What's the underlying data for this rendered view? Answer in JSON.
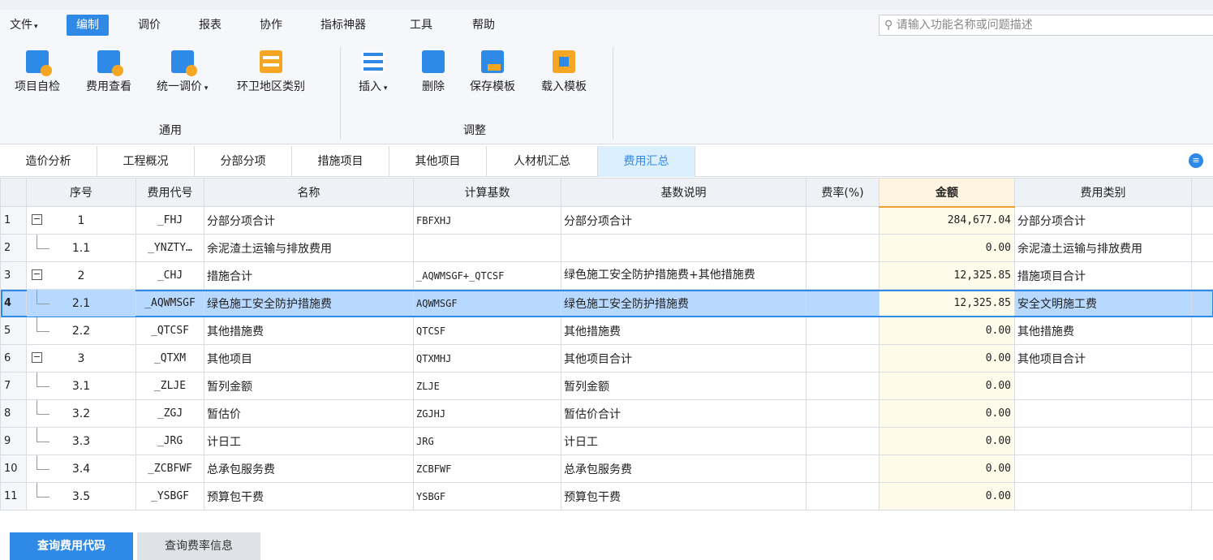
{
  "menubar": {
    "items": [
      "文件",
      "编制",
      "调价",
      "报表",
      "协作",
      "指标神器",
      "工具",
      "帮助"
    ],
    "search_placeholder": "请输入功能名称或问题描述"
  },
  "ribbon": {
    "general": [
      "项目自检",
      "费用查看",
      "统一调价",
      "环卫地区类别"
    ],
    "general_label": "通用",
    "adjust": [
      "插入",
      "删除",
      "保存模板",
      "载入模板"
    ],
    "adjust_label": "调整"
  },
  "tabs": [
    "造价分析",
    "工程概况",
    "分部分项",
    "措施项目",
    "其他项目",
    "人材机汇总",
    "费用汇总"
  ],
  "table": {
    "headers": [
      "序号",
      "费用代号",
      "名称",
      "计算基数",
      "基数说明",
      "费率(%)",
      "金额",
      "费用类别"
    ],
    "rows": [
      {
        "n": "1",
        "seq": "1",
        "code": "_FHJ",
        "name": "分部分项合计",
        "basis": "FBFXHJ",
        "desc": "分部分项合计",
        "rate": "",
        "amount": "284,677.04",
        "cat": "分部分项合计"
      },
      {
        "n": "2",
        "seq": "1.1",
        "code": "_YNZTY…",
        "name": "余泥渣土运输与排放费用",
        "basis": "",
        "desc": "",
        "rate": "",
        "amount": "0.00",
        "cat": "余泥渣土运输与排放费用"
      },
      {
        "n": "3",
        "seq": "2",
        "code": "_CHJ",
        "name": "措施合计",
        "basis": "_AQWMSGF+_QTCSF",
        "desc": "绿色施工安全防护措施费+其他措施费",
        "rate": "",
        "amount": "12,325.85",
        "cat": "措施项目合计"
      },
      {
        "n": "4",
        "seq": "2.1",
        "code": "_AQWMSGF",
        "name": "绿色施工安全防护措施费",
        "basis": "AQWMSGF",
        "desc": "绿色施工安全防护措施费",
        "rate": "",
        "amount": "12,325.85",
        "cat": "安全文明施工费"
      },
      {
        "n": "5",
        "seq": "2.2",
        "code": "_QTCSF",
        "name": "其他措施费",
        "basis": "QTCSF",
        "desc": "其他措施费",
        "rate": "",
        "amount": "0.00",
        "cat": "其他措施费"
      },
      {
        "n": "6",
        "seq": "3",
        "code": "_QTXM",
        "name": "其他项目",
        "basis": "QTXMHJ",
        "desc": "其他项目合计",
        "rate": "",
        "amount": "0.00",
        "cat": "其他项目合计"
      },
      {
        "n": "7",
        "seq": "3.1",
        "code": "_ZLJE",
        "name": "暂列金额",
        "basis": "ZLJE",
        "desc": "暂列金额",
        "rate": "",
        "amount": "0.00",
        "cat": ""
      },
      {
        "n": "8",
        "seq": "3.2",
        "code": "_ZGJ",
        "name": "暂估价",
        "basis": "ZGJHJ",
        "desc": "暂估价合计",
        "rate": "",
        "amount": "0.00",
        "cat": ""
      },
      {
        "n": "9",
        "seq": "3.3",
        "code": "_JRG",
        "name": "计日工",
        "basis": "JRG",
        "desc": "计日工",
        "rate": "",
        "amount": "0.00",
        "cat": ""
      },
      {
        "n": "10",
        "seq": "3.4",
        "code": "_ZCBFWF",
        "name": "总承包服务费",
        "basis": "ZCBFWF",
        "desc": "总承包服务费",
        "rate": "",
        "amount": "0.00",
        "cat": ""
      },
      {
        "n": "11",
        "seq": "3.5",
        "code": "_YSBGF",
        "name": "预算包干费",
        "basis": "YSBGF",
        "desc": "预算包干费",
        "rate": "",
        "amount": "0.00",
        "cat": ""
      }
    ]
  },
  "bottom": [
    "查询费用代码",
    "查询费率信息"
  ],
  "colors": {
    "accent": "#2e8ae6",
    "selected": "#b8d9ff",
    "amount_bg": "#fffbea"
  }
}
